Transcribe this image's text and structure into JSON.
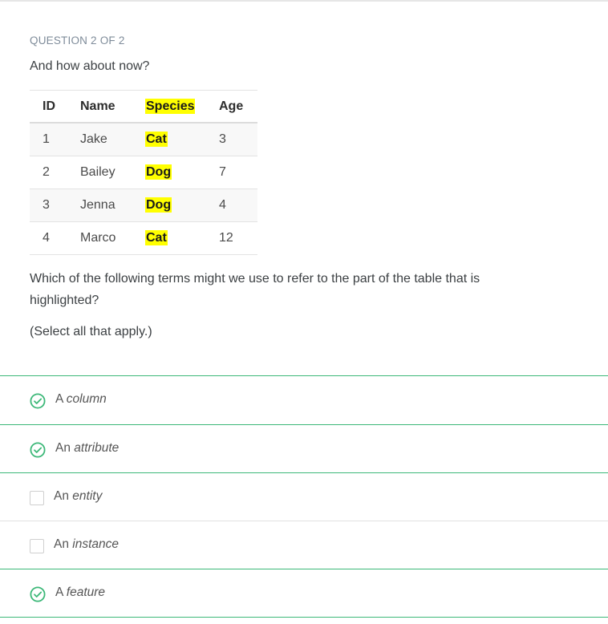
{
  "question": {
    "counter": "QUESTION 2 OF 2",
    "prompt": "And how about now?",
    "followup": "Which of the following terms might we use to refer to the part of the table that is highlighted?",
    "select_hint": "(Select all that apply.)"
  },
  "table": {
    "headers": [
      "ID",
      "Name",
      "Species",
      "Age"
    ],
    "highlighted_column": "Species",
    "highlight_color": "#ffff00",
    "rows": [
      [
        "1",
        "Jake",
        "Cat",
        "3"
      ],
      [
        "2",
        "Bailey",
        "Dog",
        "7"
      ],
      [
        "3",
        "Jenna",
        "Dog",
        "4"
      ],
      [
        "4",
        "Marco",
        "Cat",
        "12"
      ]
    ]
  },
  "options": [
    {
      "prefix": "A",
      "term": "column",
      "selected": true,
      "icon": "check-circle-icon"
    },
    {
      "prefix": "An",
      "term": "attribute",
      "selected": true,
      "icon": "check-circle-icon"
    },
    {
      "prefix": "An",
      "term": "entity",
      "selected": false,
      "icon": "empty-checkbox-icon"
    },
    {
      "prefix": "An",
      "term": "instance",
      "selected": false,
      "icon": "empty-checkbox-icon"
    },
    {
      "prefix": "A",
      "term": "feature",
      "selected": true,
      "icon": "check-circle-icon"
    }
  ],
  "colors": {
    "accent_green": "#3cb878",
    "counter_gray": "#7f8c9a"
  }
}
